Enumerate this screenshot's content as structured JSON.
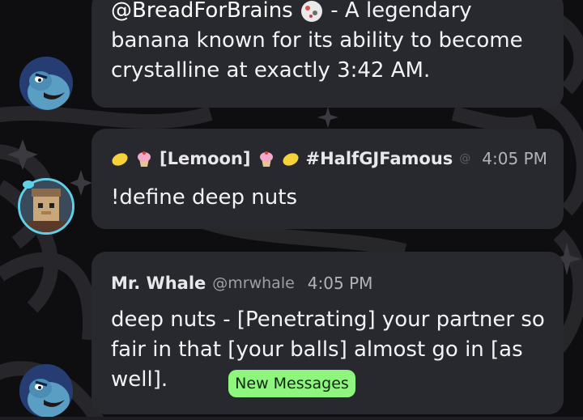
{
  "messages": [
    {
      "mention": "@BreadForBrains",
      "text_line1": " - A legendary",
      "text_line2": "banana known for its ability to become",
      "text_line3": "crystalline at exactly 3:42 AM."
    },
    {
      "author": "[Lemoon]",
      "role_tag": "#HalfGJFamous",
      "time": "4:05 PM",
      "text": "!define deep nuts",
      "emoji_left": [
        "lemon-emoji",
        "cupcake-emoji"
      ],
      "emoji_right": [
        "cupcake-emoji",
        "lemon-emoji"
      ]
    },
    {
      "author": "Mr. Whale",
      "handle": "@mrwhale",
      "time": "4:05 PM",
      "text_line1": "deep nuts - [Penetrating] your partner so",
      "text_line2": "fair in that [your balls] almost go in [as",
      "text_line3": "well]."
    }
  ],
  "new_messages_label": "New Messages",
  "colors": {
    "bubble": "#28292e",
    "new_messages_bg": "#8ef57e",
    "avatar_ring": "#5fd0e8"
  }
}
